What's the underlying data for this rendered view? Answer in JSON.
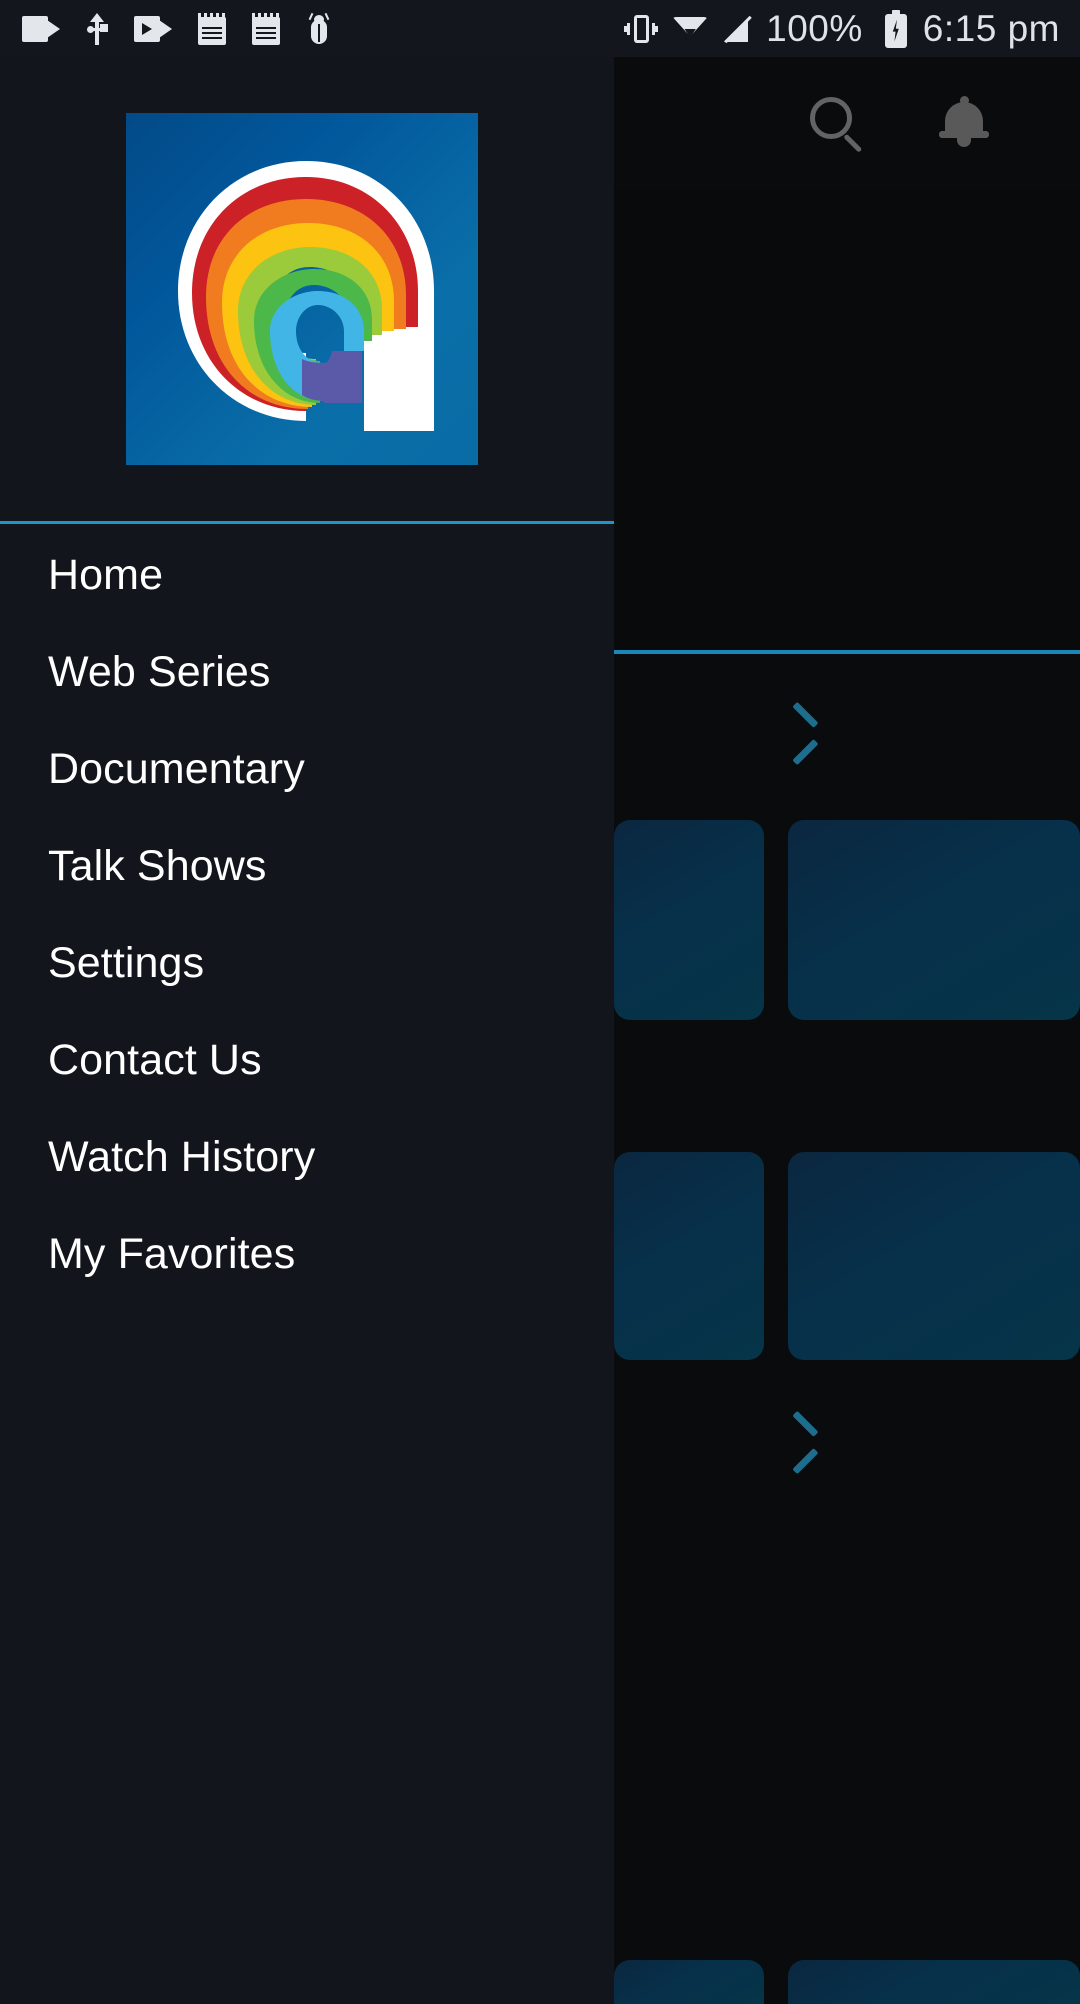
{
  "status_bar": {
    "left_icons": [
      {
        "name": "camcorder-icon"
      },
      {
        "name": "usb-icon"
      },
      {
        "name": "screen-record-icon"
      },
      {
        "name": "notepad-icon"
      },
      {
        "name": "notepad-icon-2"
      },
      {
        "name": "bug-report-icon"
      }
    ],
    "right_icons": [
      {
        "name": "vibrate-icon"
      },
      {
        "name": "wifi-icon"
      },
      {
        "name": "signal-off-icon"
      }
    ],
    "battery_percent": "100%",
    "battery_state": "charging",
    "time": "6:15 pm"
  },
  "drawer": {
    "logo_alt": "app-logo-rainbow-wave",
    "logo_colors": {
      "background": "#0a6ca5",
      "white": "#ffffff",
      "red": "#cc2127",
      "orange": "#f07c1f",
      "yellow": "#fcc311",
      "lime": "#9bcb3b",
      "green": "#4cb849",
      "cyan": "#41b6e6",
      "purple": "#5b5aa8"
    },
    "divider_color": "#2294c9",
    "items": [
      {
        "label": "Home",
        "name": "home"
      },
      {
        "label": "Web Series",
        "name": "web-series"
      },
      {
        "label": "Documentary",
        "name": "documentary"
      },
      {
        "label": "Talk Shows",
        "name": "talk-shows"
      },
      {
        "label": "Settings",
        "name": "settings"
      },
      {
        "label": "Contact Us",
        "name": "contact-us"
      },
      {
        "label": "Watch History",
        "name": "watch-history"
      },
      {
        "label": "My Favorites",
        "name": "my-favorites"
      }
    ]
  },
  "background": {
    "appbar_icons": [
      {
        "name": "search-icon"
      },
      {
        "name": "notifications-bell-icon"
      }
    ],
    "accent_color": "#1b87b8",
    "chevron_color": "#1d6e8e",
    "carousel_chevrons": 2,
    "thumbnail_count": 6
  }
}
